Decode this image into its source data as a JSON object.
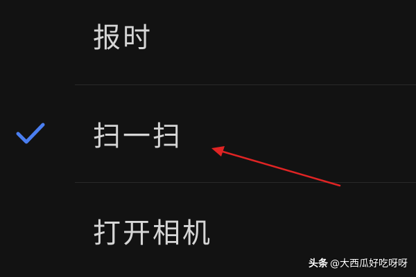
{
  "menu": {
    "options": [
      {
        "label": "报时",
        "selected": false
      },
      {
        "label": "扫一扫",
        "selected": true
      },
      {
        "label": "打开相机",
        "selected": false
      }
    ]
  },
  "colors": {
    "background": "#121212",
    "text": "#d6d6d6",
    "divider": "#2a2a2a",
    "check": "#4a7ef0",
    "annotation_arrow": "#e02424"
  },
  "icons": {
    "check": "check-icon"
  },
  "watermark": {
    "brand": "头条",
    "handle": "@大西瓜好吃呀呀"
  }
}
